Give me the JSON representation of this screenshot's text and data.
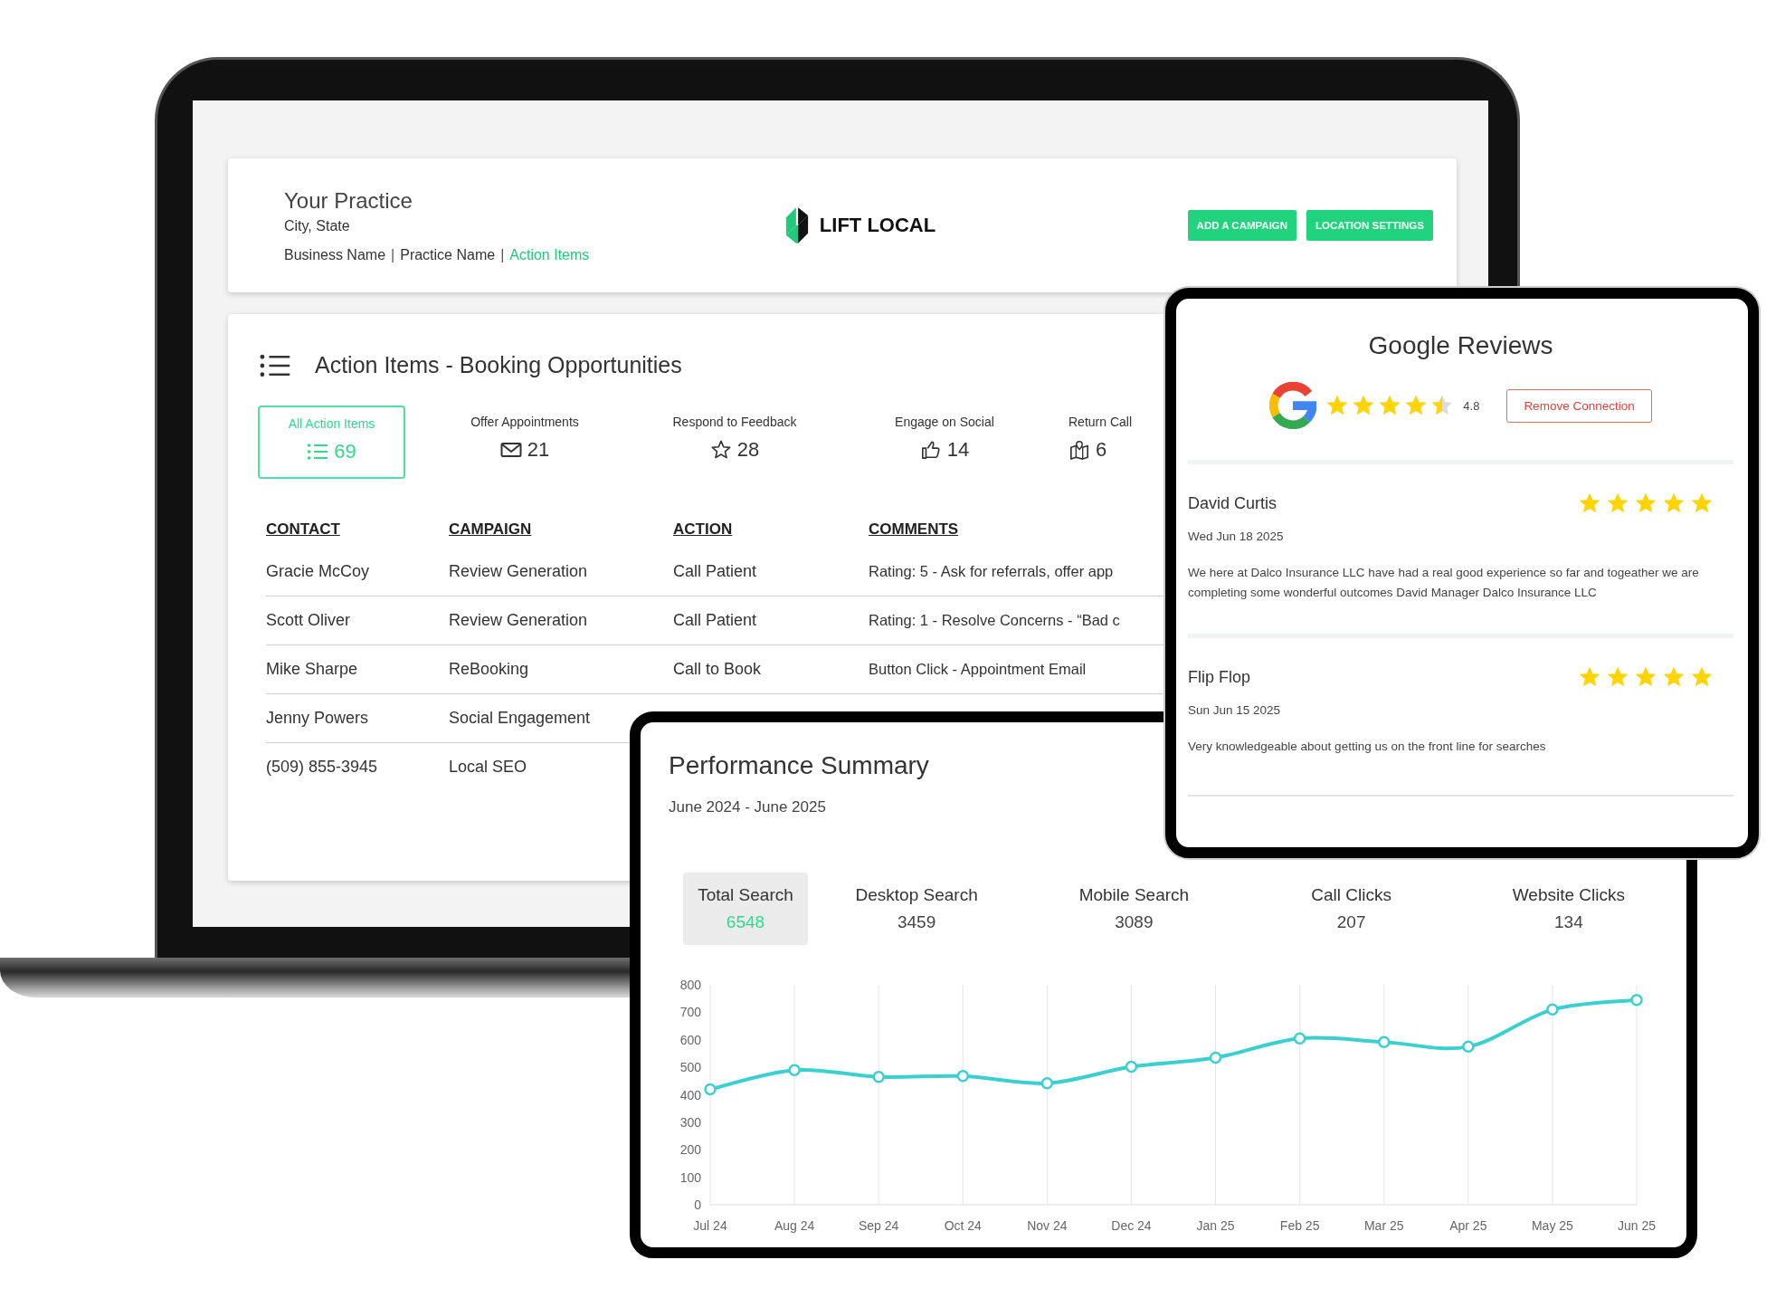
{
  "header": {
    "practice_name": "Your Practice",
    "location": "City, State",
    "breadcrumbs": [
      {
        "label": "Business Name",
        "selected": false
      },
      {
        "label": "Practice Name",
        "selected": false
      },
      {
        "label": "Action Items",
        "selected": true
      }
    ],
    "separators": [
      "|",
      "|"
    ],
    "logo_text": "LIFT LOCAL",
    "buttons": [
      "ADD A CAMPAIGN",
      "LOCATION SETTINGS"
    ]
  },
  "action_items": {
    "title": "Action Items - Booking Opportunities",
    "filters": [
      {
        "kind": "all",
        "label": "All Action Items",
        "count": "69",
        "selected": true
      },
      {
        "kind": "appointments",
        "label": "Offer Appointments",
        "count": "21",
        "selected": false
      },
      {
        "kind": "feedback",
        "label": "Respond to Feedback",
        "count": "28",
        "selected": false
      },
      {
        "kind": "social",
        "label": "Engage on Social",
        "count": "14",
        "selected": false
      },
      {
        "kind": "calls",
        "label": "Return Call",
        "count": "6",
        "selected": false
      }
    ],
    "table": {
      "columns": [
        "CONTACT",
        "CAMPAIGN",
        "ACTION",
        "COMMENTS"
      ],
      "rows": [
        [
          "Gracie McCoy",
          "Review Generation",
          "Call Patient",
          "Rating: 5 - Ask for referrals, offer app"
        ],
        [
          "Scott Oliver",
          "Review Generation",
          "Call Patient",
          "Rating: 1 - Resolve Concerns - “Bad c"
        ],
        [
          "Mike Sharpe",
          "ReBooking",
          "Call to Book",
          "Button Click - Appointment Email"
        ],
        [
          "Jenny Powers",
          "Social Engagement"
        ],
        [
          "(509) 855-3945",
          "Local SEO"
        ]
      ]
    }
  },
  "performance_summary": {
    "title": "Performance Summary",
    "date_range": "June 2024 - June 2025",
    "metrics": [
      {
        "label": "Total Search",
        "value": "6548",
        "selected": true
      },
      {
        "label": "Desktop Search",
        "value": "3459",
        "selected": false
      },
      {
        "label": "Mobile Search",
        "value": "3089",
        "selected": false
      },
      {
        "label": "Call Clicks",
        "value": "207",
        "selected": false
      },
      {
        "label": "Website Clicks",
        "value": "134",
        "selected": false
      }
    ],
    "chart_data": {
      "type": "line",
      "categories": [
        "Jul 24",
        "Aug 24",
        "Sep 24",
        "Oct 24",
        "Nov 24",
        "Dec 24",
        "Jan 25",
        "Feb 25",
        "Mar 25",
        "Apr 25",
        "May 25",
        "Jun 25"
      ],
      "grid": true,
      "series": [
        {
          "color": "#3ccfcf",
          "marker": true,
          "values": [
            420,
            490,
            465,
            468,
            442,
            502,
            535,
            605,
            592,
            575,
            710,
            745
          ]
        }
      ],
      "ylim": [
        0,
        800
      ],
      "yticks": [
        0,
        100,
        200,
        300,
        400,
        500,
        600,
        700,
        800
      ]
    }
  },
  "google_reviews": {
    "title": "Google Reviews",
    "stars": 4.5,
    "rating": "4.8",
    "button": "Remove Connection",
    "reviews": [
      {
        "name": "David Curtis",
        "date": "Wed Jun 18 2025",
        "stars": 5,
        "text": "We here at Dalco Insurance LLC have had a real good experience so far and togeather we are completing some wonderful outcomes David Manager Dalco Insurance LLC"
      },
      {
        "name": "Flip Flop",
        "date": "Sun Jun 15 2025",
        "stars": 5,
        "text": "Very knowledgeable about getting us on the front line for searches"
      }
    ]
  }
}
